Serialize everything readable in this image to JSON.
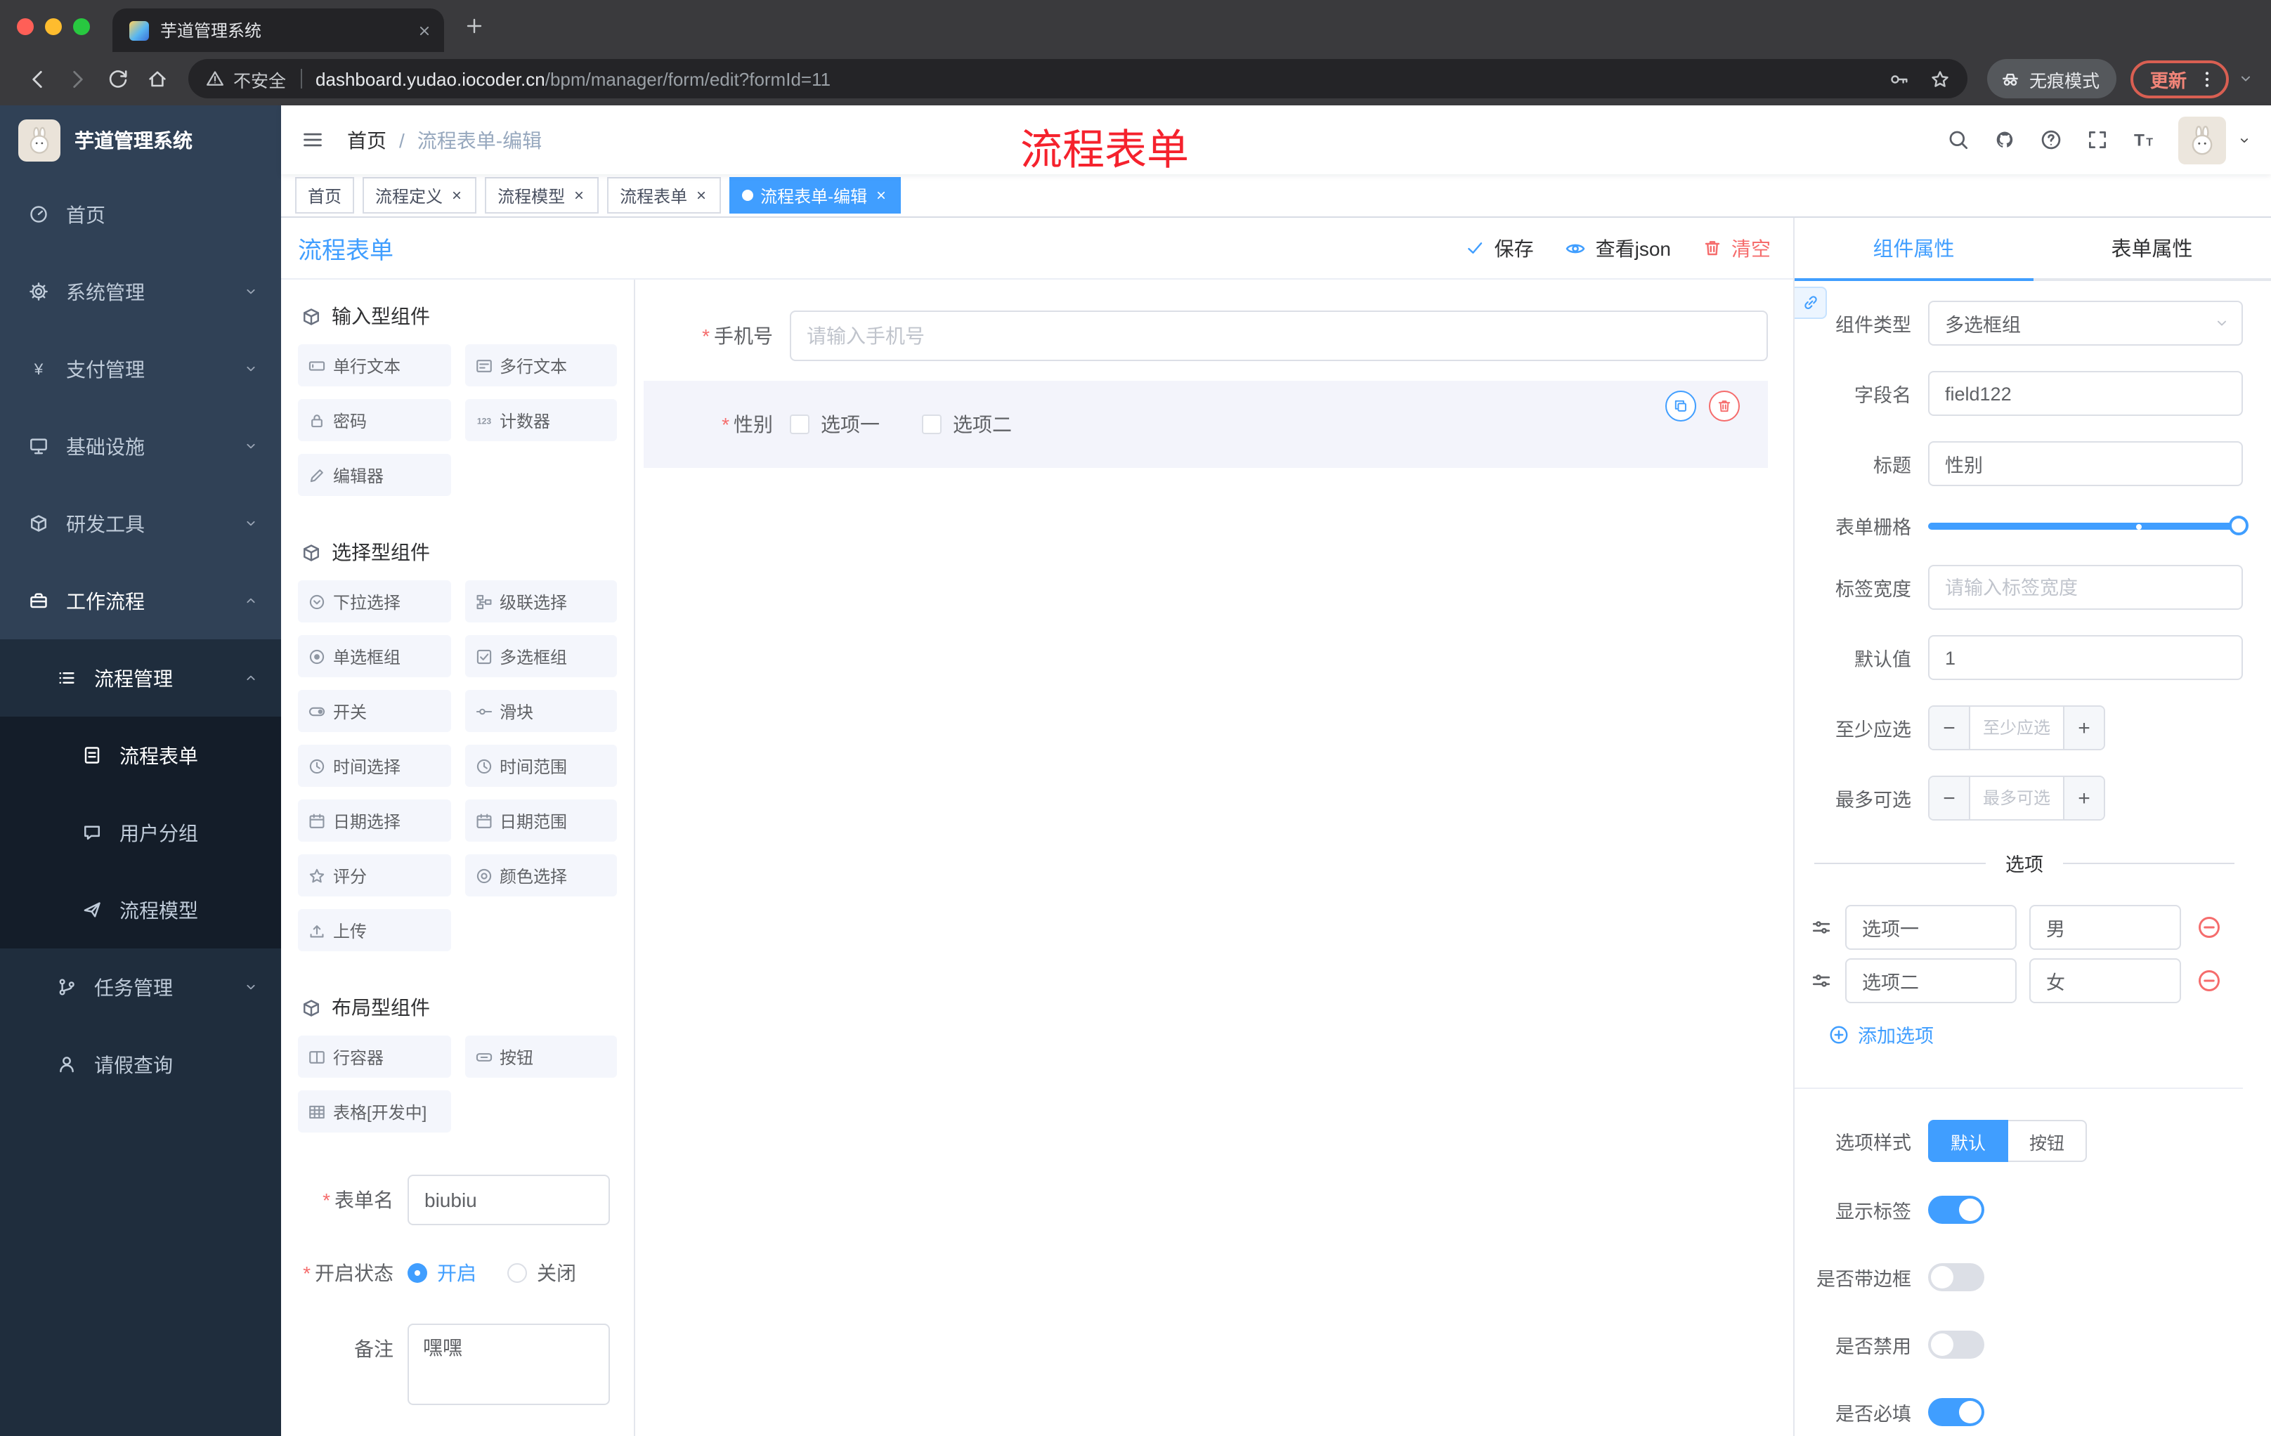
{
  "colors": {
    "accent": "#409eff",
    "danger": "#f56c6c",
    "annotation": "#f5222d",
    "sidebar_bg": "#304156"
  },
  "browser": {
    "tab_title": "芋道管理系统",
    "security_label": "不安全",
    "url_domain": "dashboard.yudao.iocoder.cn",
    "url_path": "/bpm/manager/form/edit?formId=11",
    "incognito_label": "无痕模式",
    "update_label": "更新"
  },
  "sidebar": {
    "logo_title": "芋道管理系统",
    "items": [
      {
        "label": "首页"
      },
      {
        "label": "系统管理"
      },
      {
        "label": "支付管理"
      },
      {
        "label": "基础设施"
      },
      {
        "label": "研发工具"
      },
      {
        "label": "工作流程"
      },
      {
        "label": "流程管理"
      },
      {
        "label": "流程表单"
      },
      {
        "label": "用户分组"
      },
      {
        "label": "流程模型"
      },
      {
        "label": "任务管理"
      },
      {
        "label": "请假查询"
      }
    ]
  },
  "navbar": {
    "breadcrumb_home": "首页",
    "breadcrumb_sep": "/",
    "breadcrumb_current": "流程表单-编辑",
    "annotation": "流程表单"
  },
  "tags": [
    {
      "label": "首页"
    },
    {
      "label": "流程定义"
    },
    {
      "label": "流程模型"
    },
    {
      "label": "流程表单"
    },
    {
      "label": "流程表单-编辑"
    }
  ],
  "designer": {
    "title": "流程表单",
    "actions": {
      "save": "保存",
      "view_json": "查看json",
      "clear": "清空"
    },
    "palette": {
      "sections": [
        {
          "title": "输入型组件",
          "items": [
            "单行文本",
            "多行文本",
            "密码",
            "计数器",
            "编辑器"
          ]
        },
        {
          "title": "选择型组件",
          "items": [
            "下拉选择",
            "级联选择",
            "单选框组",
            "多选框组",
            "开关",
            "滑块",
            "时间选择",
            "时间范围",
            "日期选择",
            "日期范围",
            "评分",
            "颜色选择",
            "上传"
          ]
        },
        {
          "title": "布局型组件",
          "items": [
            "行容器",
            "按钮",
            "表格[开发中]"
          ]
        }
      ]
    },
    "meta": {
      "form_name_label": "表单名",
      "form_name_value": "biubiu",
      "status_label": "开启状态",
      "status_on": "开启",
      "status_off": "关闭",
      "remark_label": "备注",
      "remark_value": "嘿嘿"
    },
    "canvas": {
      "phone_label": "手机号",
      "phone_placeholder": "请输入手机号",
      "gender_label": "性别",
      "gender_opt1": "选项一",
      "gender_opt2": "选项二"
    }
  },
  "props": {
    "tab_component": "组件属性",
    "tab_form": "表单属性",
    "component_type_label": "组件类型",
    "component_type_value": "多选框组",
    "field_label": "字段名",
    "field_value": "field122",
    "title_label": "标题",
    "title_value": "性别",
    "grid_label": "表单栅格",
    "label_width_label": "标签宽度",
    "label_width_placeholder": "请输入标签宽度",
    "default_label": "默认值",
    "default_value": "1",
    "min_label": "至少应选",
    "min_placeholder": "至少应选",
    "max_label": "最多可选",
    "max_placeholder": "最多可选",
    "stepper_minus": "−",
    "stepper_plus": "+",
    "options_title": "选项",
    "option_rows": [
      {
        "name": "选项一",
        "value": "男"
      },
      {
        "name": "选项二",
        "value": "女"
      }
    ],
    "add_option": "添加选项",
    "style_label": "选项样式",
    "style_default": "默认",
    "style_button": "按钮",
    "switches": [
      {
        "label": "显示标签",
        "on": true
      },
      {
        "label": "是否带边框",
        "on": false
      },
      {
        "label": "是否禁用",
        "on": false
      },
      {
        "label": "是否必填",
        "on": true
      }
    ]
  }
}
